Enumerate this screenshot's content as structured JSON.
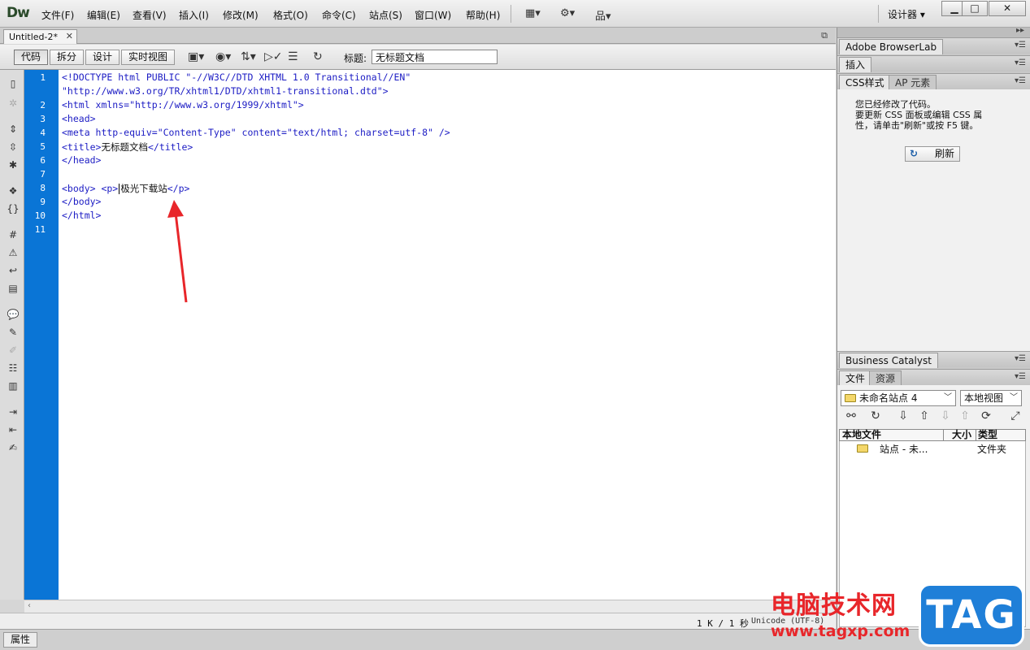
{
  "app": {
    "logo": "Dw",
    "menu": [
      "文件(F)",
      "编辑(E)",
      "查看(V)",
      "插入(I)",
      "修改(M)",
      "格式(O)",
      "命令(C)",
      "站点(S)",
      "窗口(W)",
      "帮助(H)"
    ],
    "workspace": "设计器",
    "workspace_arrow": "▾"
  },
  "document": {
    "tab": "Untitled-2*",
    "views": [
      "代码",
      "拆分",
      "设计",
      "实时视图"
    ],
    "active_view": "代码",
    "title_label": "标题:",
    "title_value": "无标题文档"
  },
  "code": {
    "lines": [
      {
        "num": "1",
        "text": "<!DOCTYPE html PUBLIC \"-//W3C//DTD XHTML 1.0 Transitional//EN\""
      },
      {
        "num": "",
        "text": "\"http://www.w3.org/TR/xhtml1/DTD/xhtml1-transitional.dtd\">"
      },
      {
        "num": "2",
        "text": "<html xmlns=\"http://www.w3.org/1999/xhtml\">"
      },
      {
        "num": "3",
        "text": "<head>"
      },
      {
        "num": "4",
        "text": "<meta http-equiv=\"Content-Type\" content=\"text/html; charset=utf-8\" />"
      },
      {
        "num": "5",
        "pre": "<title>",
        "inner": "无标题文档",
        "post": "</title>"
      },
      {
        "num": "6",
        "text": "</head>"
      },
      {
        "num": "7",
        "text": ""
      },
      {
        "num": "8",
        "pre": "<body> <p>",
        "inner": "极光下载站",
        "post": "</p>",
        "caret": true
      },
      {
        "num": "9",
        "text": "</body>"
      },
      {
        "num": "10",
        "text": "</html>"
      },
      {
        "num": "11",
        "text": ""
      }
    ]
  },
  "status": {
    "size": "1 K / 1 秒",
    "encoding": "Unicode (UTF-8)"
  },
  "properties_tab": "属性",
  "panels": {
    "browserlab": "Adobe BrowserLab",
    "insert": "插入",
    "css_tabs": [
      "CSS样式",
      "AP 元素"
    ],
    "css_message": "您已经修改了代码。\n要更新 CSS 面板或编辑 CSS 属\n性，请单击\"刷新\"或按 F5 键。",
    "refresh_label": "刷新",
    "business_catalyst": "Business Catalyst",
    "files_tabs": [
      "文件",
      "资源"
    ],
    "site_select": "未命名站点 4",
    "view_select": "本地视图",
    "file_columns": [
      "本地文件",
      "大小",
      "类型"
    ],
    "file_rows": [
      {
        "name": "站点 - 未...",
        "size": "",
        "type": "文件夹"
      }
    ]
  },
  "watermark": {
    "text": "电脑技术网",
    "url": "www.tagxp.com",
    "tag": "TAG"
  },
  "colors": {
    "gutter": "#0a75d6",
    "code_tag": "#1c1cc4",
    "arrow": "#e8262a"
  }
}
